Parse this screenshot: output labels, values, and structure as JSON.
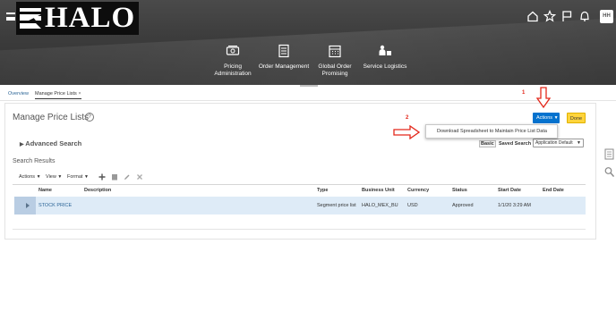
{
  "brand": {
    "logo_text": "HALO"
  },
  "header": {
    "user_initials": "HH",
    "nav": [
      {
        "label": "Pricing Administration",
        "icon": "pricing-icon"
      },
      {
        "label": "Order Management",
        "icon": "order-management-icon"
      },
      {
        "label": "Global Order Promising",
        "icon": "calendar-icon"
      },
      {
        "label": "Service Logistics",
        "icon": "service-logistics-icon"
      }
    ],
    "icons": [
      "home-icon",
      "star-icon",
      "flag-icon",
      "bell-icon"
    ]
  },
  "tabs": [
    {
      "label": "Overview"
    },
    {
      "label": "Manage Price Lists",
      "close": "×",
      "active": true
    }
  ],
  "page": {
    "title": "Manage Price Lists",
    "help": "?",
    "actions_label": "Actions",
    "done_label": "Done",
    "dropdown_item": "Download Spreadsheet to Maintain Price List Data",
    "annotations": [
      "1",
      "2"
    ],
    "advanced_search": "Advanced Search",
    "basic": "Basic",
    "saved_search_label": "Saved Search",
    "saved_search_value": "Application Default"
  },
  "results": {
    "title": "Search Results",
    "toolbar": {
      "actions": "Actions",
      "view": "View",
      "format": "Format"
    },
    "columns": [
      "Name",
      "Description",
      "Type",
      "Business Unit",
      "Currency",
      "Status",
      "Start Date",
      "End Date"
    ],
    "rows": [
      {
        "name": "STOCK PRICE",
        "description": "",
        "type": "Segment price list",
        "business_unit": "HALO_MEX_BU",
        "currency": "USD",
        "status": "Approved",
        "start_date": "1/1/20 3:29 AM",
        "end_date": ""
      }
    ]
  },
  "colors": {
    "header_bg": "#3c3c3c",
    "primary_button": "#0572ce",
    "done_button": "#ffd43c",
    "annotation": "#e3281b",
    "selected_row": "#deebf7",
    "link": "#2a6496"
  }
}
